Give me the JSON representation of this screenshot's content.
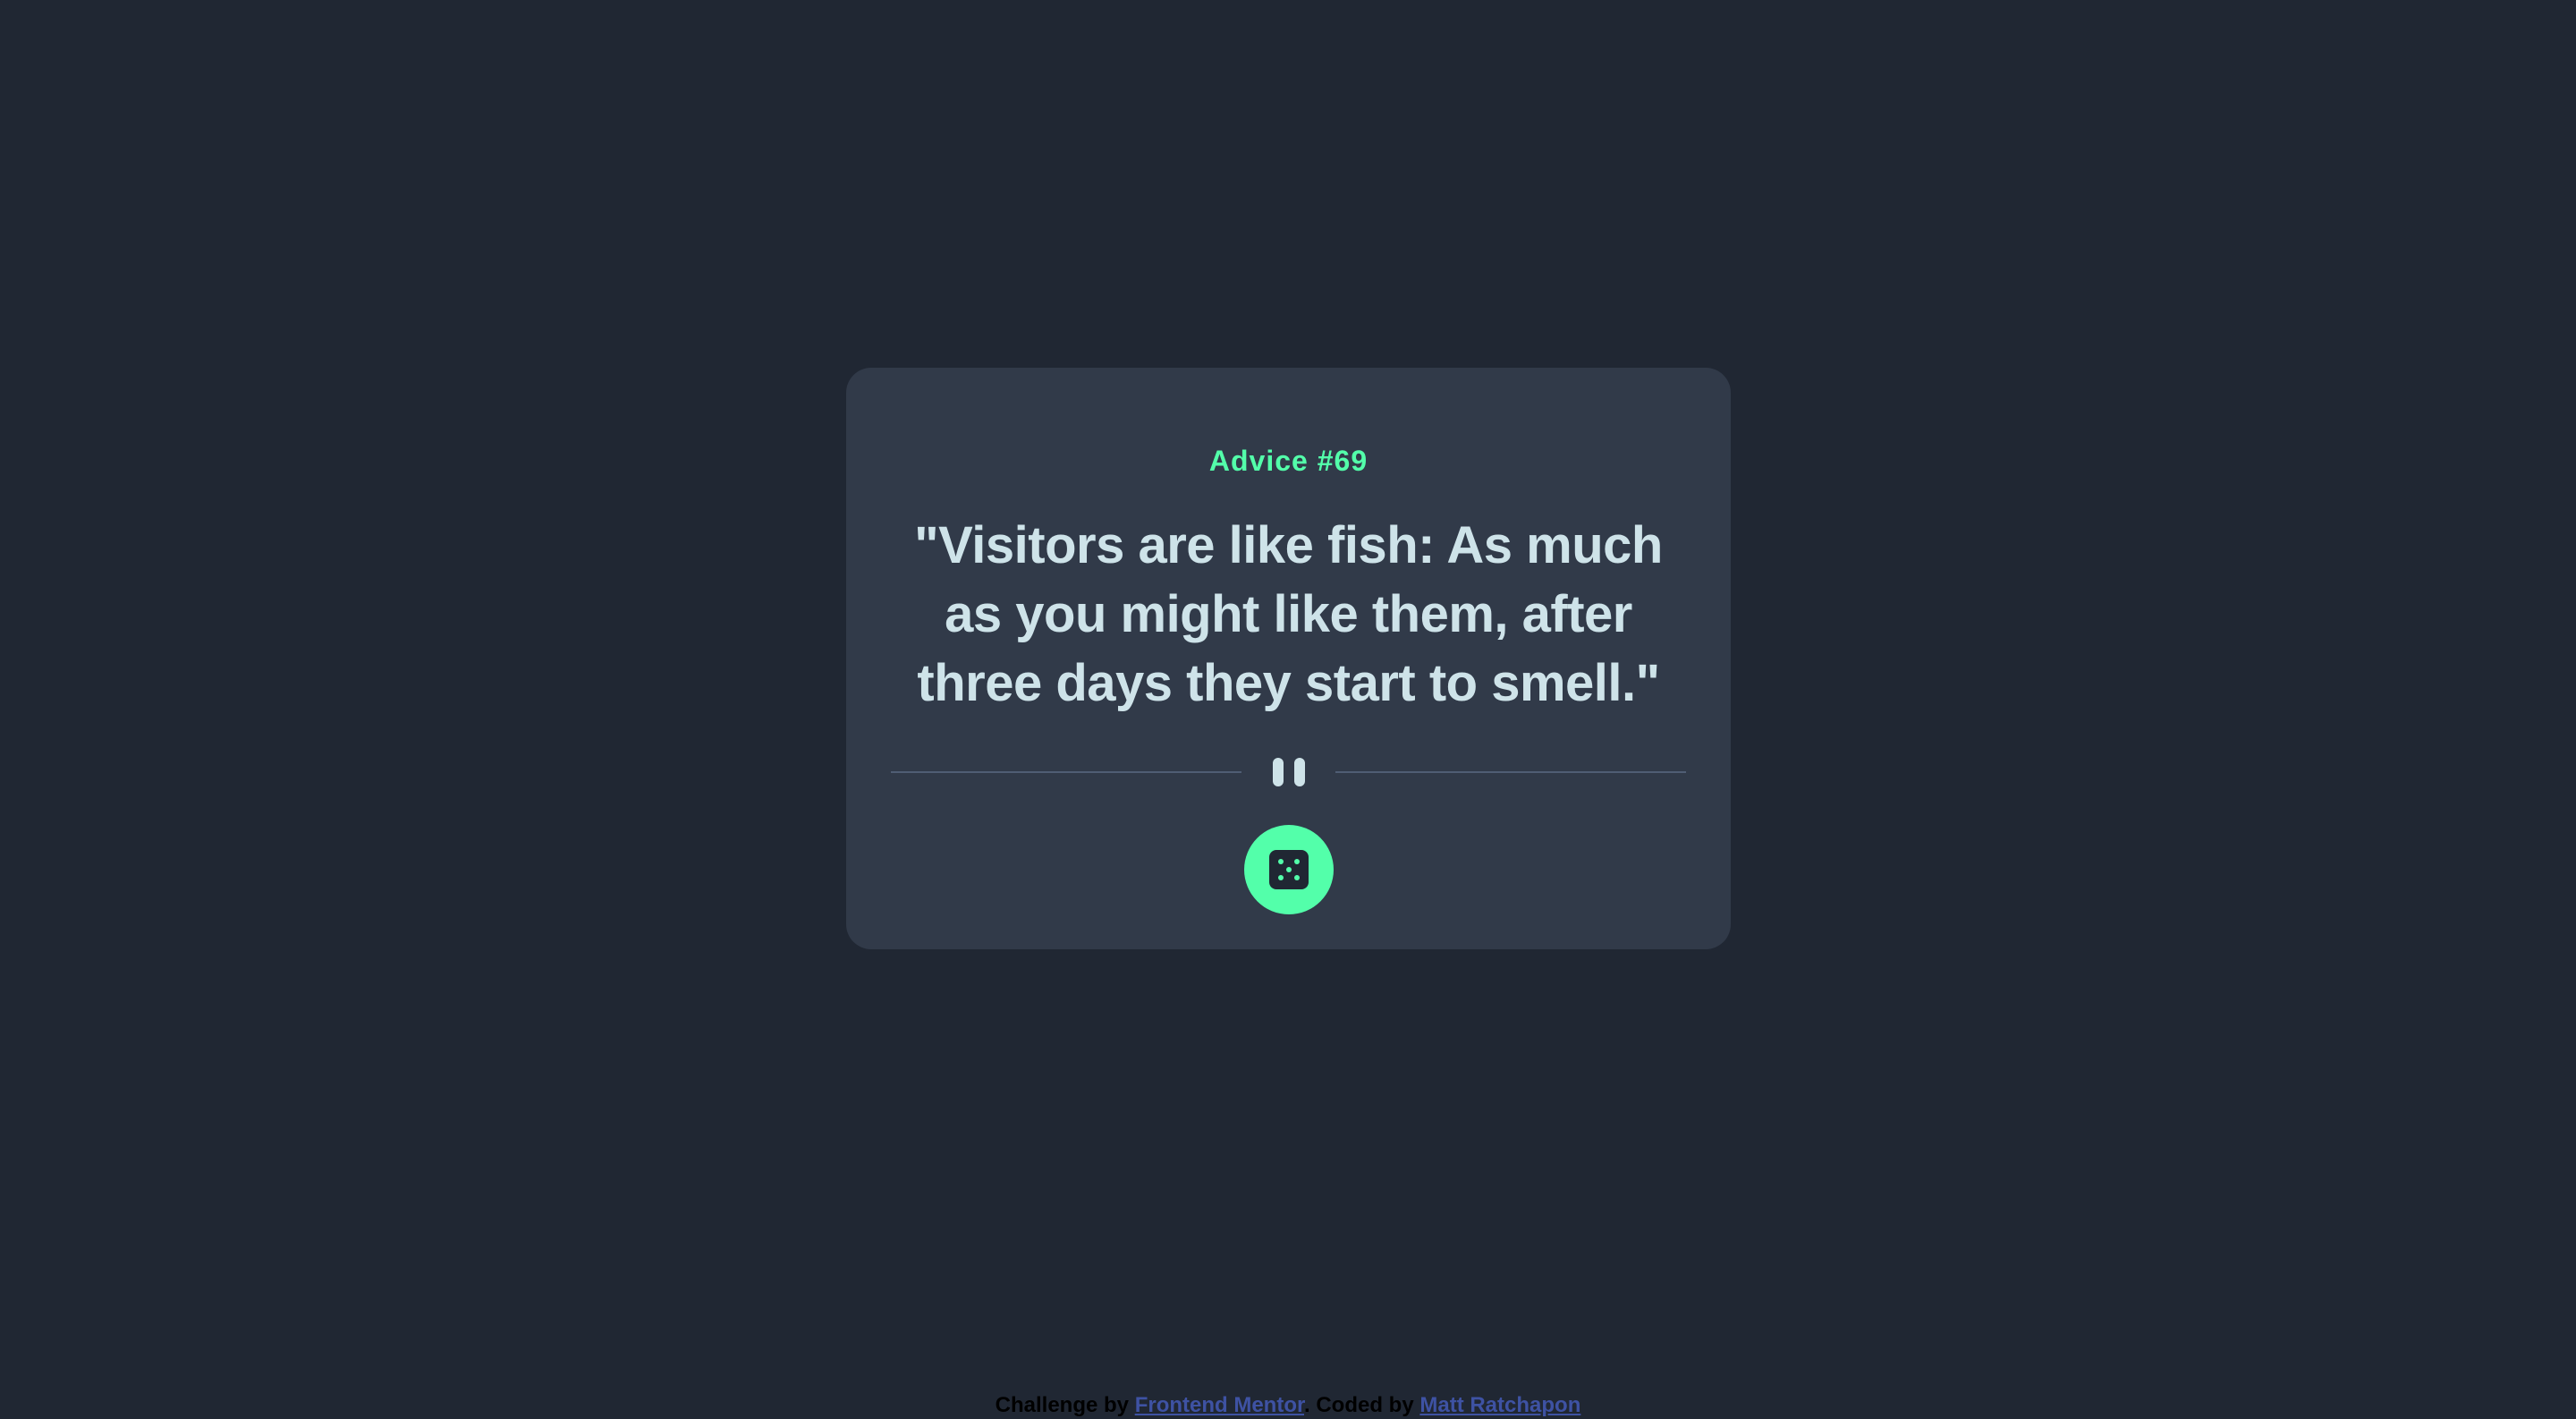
{
  "advice": {
    "label": "Advice #69",
    "quote": "\"Visitors are like fish: As much as you might like them, after three days they start to smell.\""
  },
  "divider": {
    "icon": "pause-icon"
  },
  "dice_button": {
    "icon": "dice-icon"
  },
  "footer": {
    "challenge_prefix": "Challenge by",
    "challenge_link": "Frontend Mentor",
    "separator": ". Coded by",
    "author_link": "Matt Ratchapon"
  },
  "colors": {
    "background": "#202733",
    "card": "#313A49",
    "accent": "#53FFAA",
    "quote_text": "#CEE3E9",
    "divider": "#4F5D74",
    "link": "#3E52A3"
  }
}
